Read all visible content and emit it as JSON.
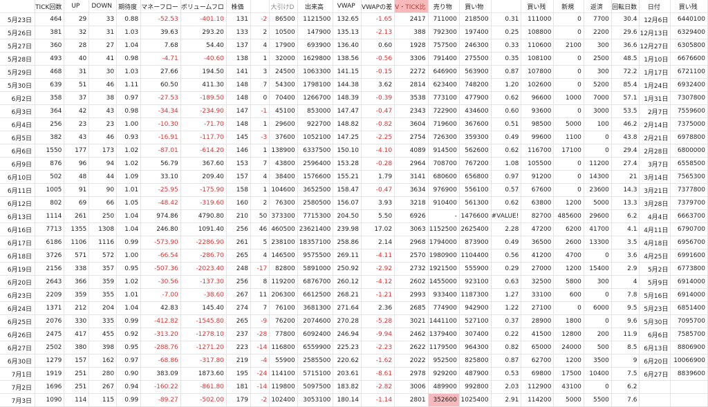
{
  "headers": [
    "",
    "TICK回数",
    "UP",
    "DOWN",
    "期待度",
    "マネーフロー",
    "ボリュームフロ",
    "株価",
    "",
    "大引けD",
    "出来高",
    "VWAP",
    "VWAPの差",
    "V・TICK比",
    "売り物",
    "買い物",
    "",
    "買い残",
    "新規",
    "返済",
    "回転日数",
    "日付",
    "買い残"
  ],
  "rows": [
    [
      "5月23日",
      "464",
      "29",
      "33",
      "0.88",
      "-52.53",
      "-401.10",
      "131",
      "-2",
      "86500",
      "1121500",
      "132.65",
      "-1.65",
      "2417",
      "711000",
      "218500",
      "0.31",
      "111000",
      "0",
      "7700",
      "30.4",
      "12月6日",
      "6440100"
    ],
    [
      "5月26日",
      "381",
      "32",
      "31",
      "1.03",
      "39.63",
      "293.20",
      "133",
      "2",
      "10500",
      "147900",
      "135.13",
      "-2.13",
      "388",
      "792300",
      "197400",
      "0.25",
      "108800",
      "0",
      "2200",
      "29.6",
      "12月13日",
      "6329400"
    ],
    [
      "5月27日",
      "360",
      "28",
      "27",
      "1.04",
      "7.68",
      "54.40",
      "137",
      "4",
      "17900",
      "693900",
      "136.40",
      "0.60",
      "1928",
      "757500",
      "246300",
      "0.33",
      "110600",
      "2100",
      "300",
      "36.6",
      "12月27日",
      "6305800"
    ],
    [
      "5月28日",
      "493",
      "40",
      "41",
      "0.98",
      "-4.71",
      "-40.60",
      "138",
      "1",
      "32000",
      "1629800",
      "138.56",
      "-0.56",
      "3306",
      "791400",
      "275500",
      "0.35",
      "108100",
      "0",
      "2500",
      "48.5",
      "1月10日",
      "6676600"
    ],
    [
      "5月29日",
      "468",
      "31",
      "30",
      "1.03",
      "27.66",
      "194.50",
      "141",
      "3",
      "24500",
      "1063300",
      "141.15",
      "-0.15",
      "2272",
      "646900",
      "563900",
      "0.87",
      "107800",
      "0",
      "300",
      "72.2",
      "1月17日",
      "6721100"
    ],
    [
      "5月30日",
      "639",
      "51",
      "46",
      "1.11",
      "60.50",
      "411.30",
      "148",
      "7",
      "54300",
      "1798100",
      "144.38",
      "3.62",
      "2814",
      "623400",
      "748200",
      "1.20",
      "102600",
      "0",
      "5200",
      "85.4",
      "1月24日",
      "6932400"
    ],
    [
      "6月2日",
      "358",
      "37",
      "38",
      "0.97",
      "-27.53",
      "-189.50",
      "148",
      "0",
      "70400",
      "1266700",
      "148.39",
      "-0.39",
      "3538",
      "773100",
      "477900",
      "0.62",
      "96600",
      "1000",
      "7000",
      "57.1",
      "1月31日",
      "7307800"
    ],
    [
      "6月3日",
      "364",
      "42",
      "43",
      "0.98",
      "-34.34",
      "-234.90",
      "147",
      "-1",
      "45100",
      "853000",
      "147.47",
      "-0.47",
      "2343",
      "722900",
      "434600",
      "0.60",
      "93600",
      "0",
      "3000",
      "53.5",
      "2月7日",
      "7559600"
    ],
    [
      "6月4日",
      "256",
      "23",
      "23",
      "1.00",
      "-10.30",
      "-71.70",
      "148",
      "1",
      "29600",
      "922700",
      "148.82",
      "-0.82",
      "3604",
      "719600",
      "367600",
      "0.51",
      "98500",
      "5000",
      "100",
      "46.2",
      "2月14日",
      "7375000"
    ],
    [
      "6月5日",
      "382",
      "43",
      "46",
      "0.93",
      "-16.91",
      "-117.70",
      "145",
      "-3",
      "37600",
      "1052100",
      "147.25",
      "-2.25",
      "2754",
      "726300",
      "359300",
      "0.49",
      "99600",
      "1100",
      "0",
      "43.8",
      "2月21日",
      "6978800"
    ],
    [
      "6月6日",
      "1550",
      "177",
      "173",
      "1.02",
      "-87.01",
      "-614.20",
      "146",
      "1",
      "138900",
      "6337500",
      "150.10",
      "-4.10",
      "4089",
      "914500",
      "562600",
      "0.62",
      "116700",
      "17100",
      "0",
      "29.4",
      "2月28日",
      "6800000"
    ],
    [
      "6月9日",
      "876",
      "96",
      "94",
      "1.02",
      "56.79",
      "367.60",
      "153",
      "7",
      "43800",
      "2596400",
      "153.28",
      "-0.28",
      "2964",
      "708700",
      "767200",
      "1.08",
      "105500",
      "0",
      "11200",
      "27.4",
      "3月7日",
      "6558500"
    ],
    [
      "6月10日",
      "502",
      "48",
      "44",
      "1.09",
      "33.10",
      "209.40",
      "157",
      "4",
      "38400",
      "1576600",
      "155.21",
      "1.79",
      "3141",
      "680600",
      "656800",
      "0.97",
      "91200",
      "0",
      "14300",
      "21",
      "3月14日",
      "7565300"
    ],
    [
      "6月11日",
      "1005",
      "91",
      "90",
      "1.01",
      "-25.95",
      "-175.90",
      "158",
      "1",
      "104600",
      "3652500",
      "158.47",
      "-0.47",
      "3634",
      "976900",
      "556100",
      "0.57",
      "67600",
      "0",
      "23600",
      "14.3",
      "3月21日",
      "7377800"
    ],
    [
      "6月12日",
      "802",
      "69",
      "66",
      "1.05",
      "-48.42",
      "-319.60",
      "160",
      "2",
      "76300",
      "2580500",
      "156.07",
      "3.93",
      "3218",
      "910400",
      "561300",
      "0.62",
      "63800",
      "1200",
      "5000",
      "13.3",
      "3月28日",
      "7379700"
    ],
    [
      "6月13日",
      "1114",
      "261",
      "250",
      "1.04",
      "974.86",
      "4790.80",
      "210",
      "50",
      "373300",
      "7715300",
      "204.50",
      "5.50",
      "6926",
      "-",
      "1476600",
      "#VALUE!",
      "82700",
      "485600",
      "29600",
      "6.2",
      "4月4日",
      "6663700"
    ],
    [
      "6月16日",
      "7713",
      "1355",
      "1308",
      "1.04",
      "246.80",
      "1091.40",
      "256",
      "46",
      "460500",
      "23621400",
      "239.98",
      "17.02",
      "3063",
      "1152500",
      "2625400",
      "2.28",
      "47200",
      "6200",
      "41700",
      "4.1",
      "4月11日",
      "6790700"
    ],
    [
      "6月17日",
      "6186",
      "1106",
      "1116",
      "0.99",
      "-573.90",
      "-2286.90",
      "261",
      "5",
      "238100",
      "18357100",
      "258.86",
      "2.14",
      "2968",
      "1794000",
      "873900",
      "0.49",
      "36500",
      "2600",
      "13300",
      "3.5",
      "4月18日",
      "6956700"
    ],
    [
      "6月18日",
      "3726",
      "571",
      "572",
      "1.00",
      "-66.54",
      "-286.70",
      "265",
      "4",
      "146500",
      "9575500",
      "269.11",
      "-4.11",
      "2570",
      "1980900",
      "1104400",
      "0.56",
      "41200",
      "4700",
      "0",
      "3.6",
      "4月25日",
      "6991600"
    ],
    [
      "6月19日",
      "2156",
      "338",
      "357",
      "0.95",
      "-507.36",
      "-2023.40",
      "248",
      "-17",
      "82800",
      "5891000",
      "250.92",
      "-2.92",
      "2732",
      "1921500",
      "555900",
      "0.29",
      "27000",
      "1200",
      "15400",
      "2.9",
      "5月2日",
      "6773800"
    ],
    [
      "6月20日",
      "2643",
      "366",
      "359",
      "1.02",
      "-30.56",
      "-137.30",
      "256",
      "8",
      "119200",
      "6876700",
      "260.12",
      "-4.12",
      "2602",
      "1455000",
      "923100",
      "0.63",
      "32500",
      "5800",
      "300",
      "4",
      "5月9日",
      "6914000"
    ],
    [
      "6月23日",
      "2209",
      "359",
      "355",
      "1.01",
      "-7.00",
      "-38.60",
      "267",
      "11",
      "206300",
      "6612500",
      "268.21",
      "-1.21",
      "2993",
      "933400",
      "1187300",
      "1.27",
      "33100",
      "600",
      "0",
      "7.8",
      "5月16日",
      "6914000"
    ],
    [
      "6月24日",
      "1371",
      "212",
      "204",
      "1.04",
      "42.83",
      "145.40",
      "274",
      "7",
      "76100",
      "3681300",
      "271.64",
      "2.36",
      "2685",
      "774900",
      "942900",
      "1.22",
      "27100",
      "0",
      "6000",
      "9.5",
      "5月23日",
      "6851400"
    ],
    [
      "6月25日",
      "2076",
      "330",
      "335",
      "0.99",
      "-412.82",
      "-1545.80",
      "265",
      "-9",
      "76200",
      "2074600",
      "270.28",
      "-5.28",
      "3021",
      "1441100",
      "527100",
      "0.37",
      "28900",
      "1800",
      "0",
      "9.6",
      "5月30日",
      "7095700"
    ],
    [
      "6月26日",
      "2475",
      "417",
      "455",
      "0.92",
      "-313.20",
      "-1278.10",
      "237",
      "-28",
      "77800",
      "6092400",
      "246.94",
      "-9.94",
      "2462",
      "1379400",
      "307400",
      "0.22",
      "41500",
      "12800",
      "200",
      "11.9",
      "6月6日",
      "7585700"
    ],
    [
      "6月27日",
      "2502",
      "380",
      "398",
      "0.95",
      "-288.76",
      "-1271.20",
      "223",
      "-14",
      "116800",
      "6559900",
      "225.23",
      "-2.23",
      "2622",
      "1179500",
      "964300",
      "0.82",
      "65000",
      "24000",
      "500",
      "8.5",
      "6月13日",
      "8806900"
    ],
    [
      "6月30日",
      "1279",
      "157",
      "162",
      "0.97",
      "-68.86",
      "-317.80",
      "219",
      "-4",
      "55900",
      "2585500",
      "220.62",
      "-1.62",
      "2022",
      "952500",
      "825800",
      "0.87",
      "62700",
      "1200",
      "3500",
      "9",
      "6月20日",
      "10066900"
    ],
    [
      "7月1日",
      "1919",
      "251",
      "280",
      "0.90",
      "383.09",
      "1873.60",
      "195",
      "-24",
      "114100",
      "5715100",
      "203.61",
      "-8.61",
      "2978",
      "929200",
      "487900",
      "0.53",
      "69800",
      "17500",
      "10400",
      "7.5",
      "6月27日",
      "8839600"
    ],
    [
      "7月2日",
      "1696",
      "251",
      "267",
      "0.94",
      "-160.22",
      "-861.80",
      "181",
      "-14",
      "119800",
      "5097500",
      "183.82",
      "-2.82",
      "3006",
      "489900",
      "992800",
      "2.03",
      "112900",
      "43100",
      "0",
      "6.2",
      "",
      ""
    ],
    [
      "7月3日",
      "1090",
      "114",
      "115",
      "0.99",
      "-89.27",
      "-502.00",
      "179",
      "-2",
      "102400",
      "3053100",
      "180.14",
      "-1.14",
      "2801",
      "352600",
      "1025400",
      "2.91",
      "114200",
      "5000",
      "5500",
      "7.6",
      "",
      ""
    ]
  ]
}
